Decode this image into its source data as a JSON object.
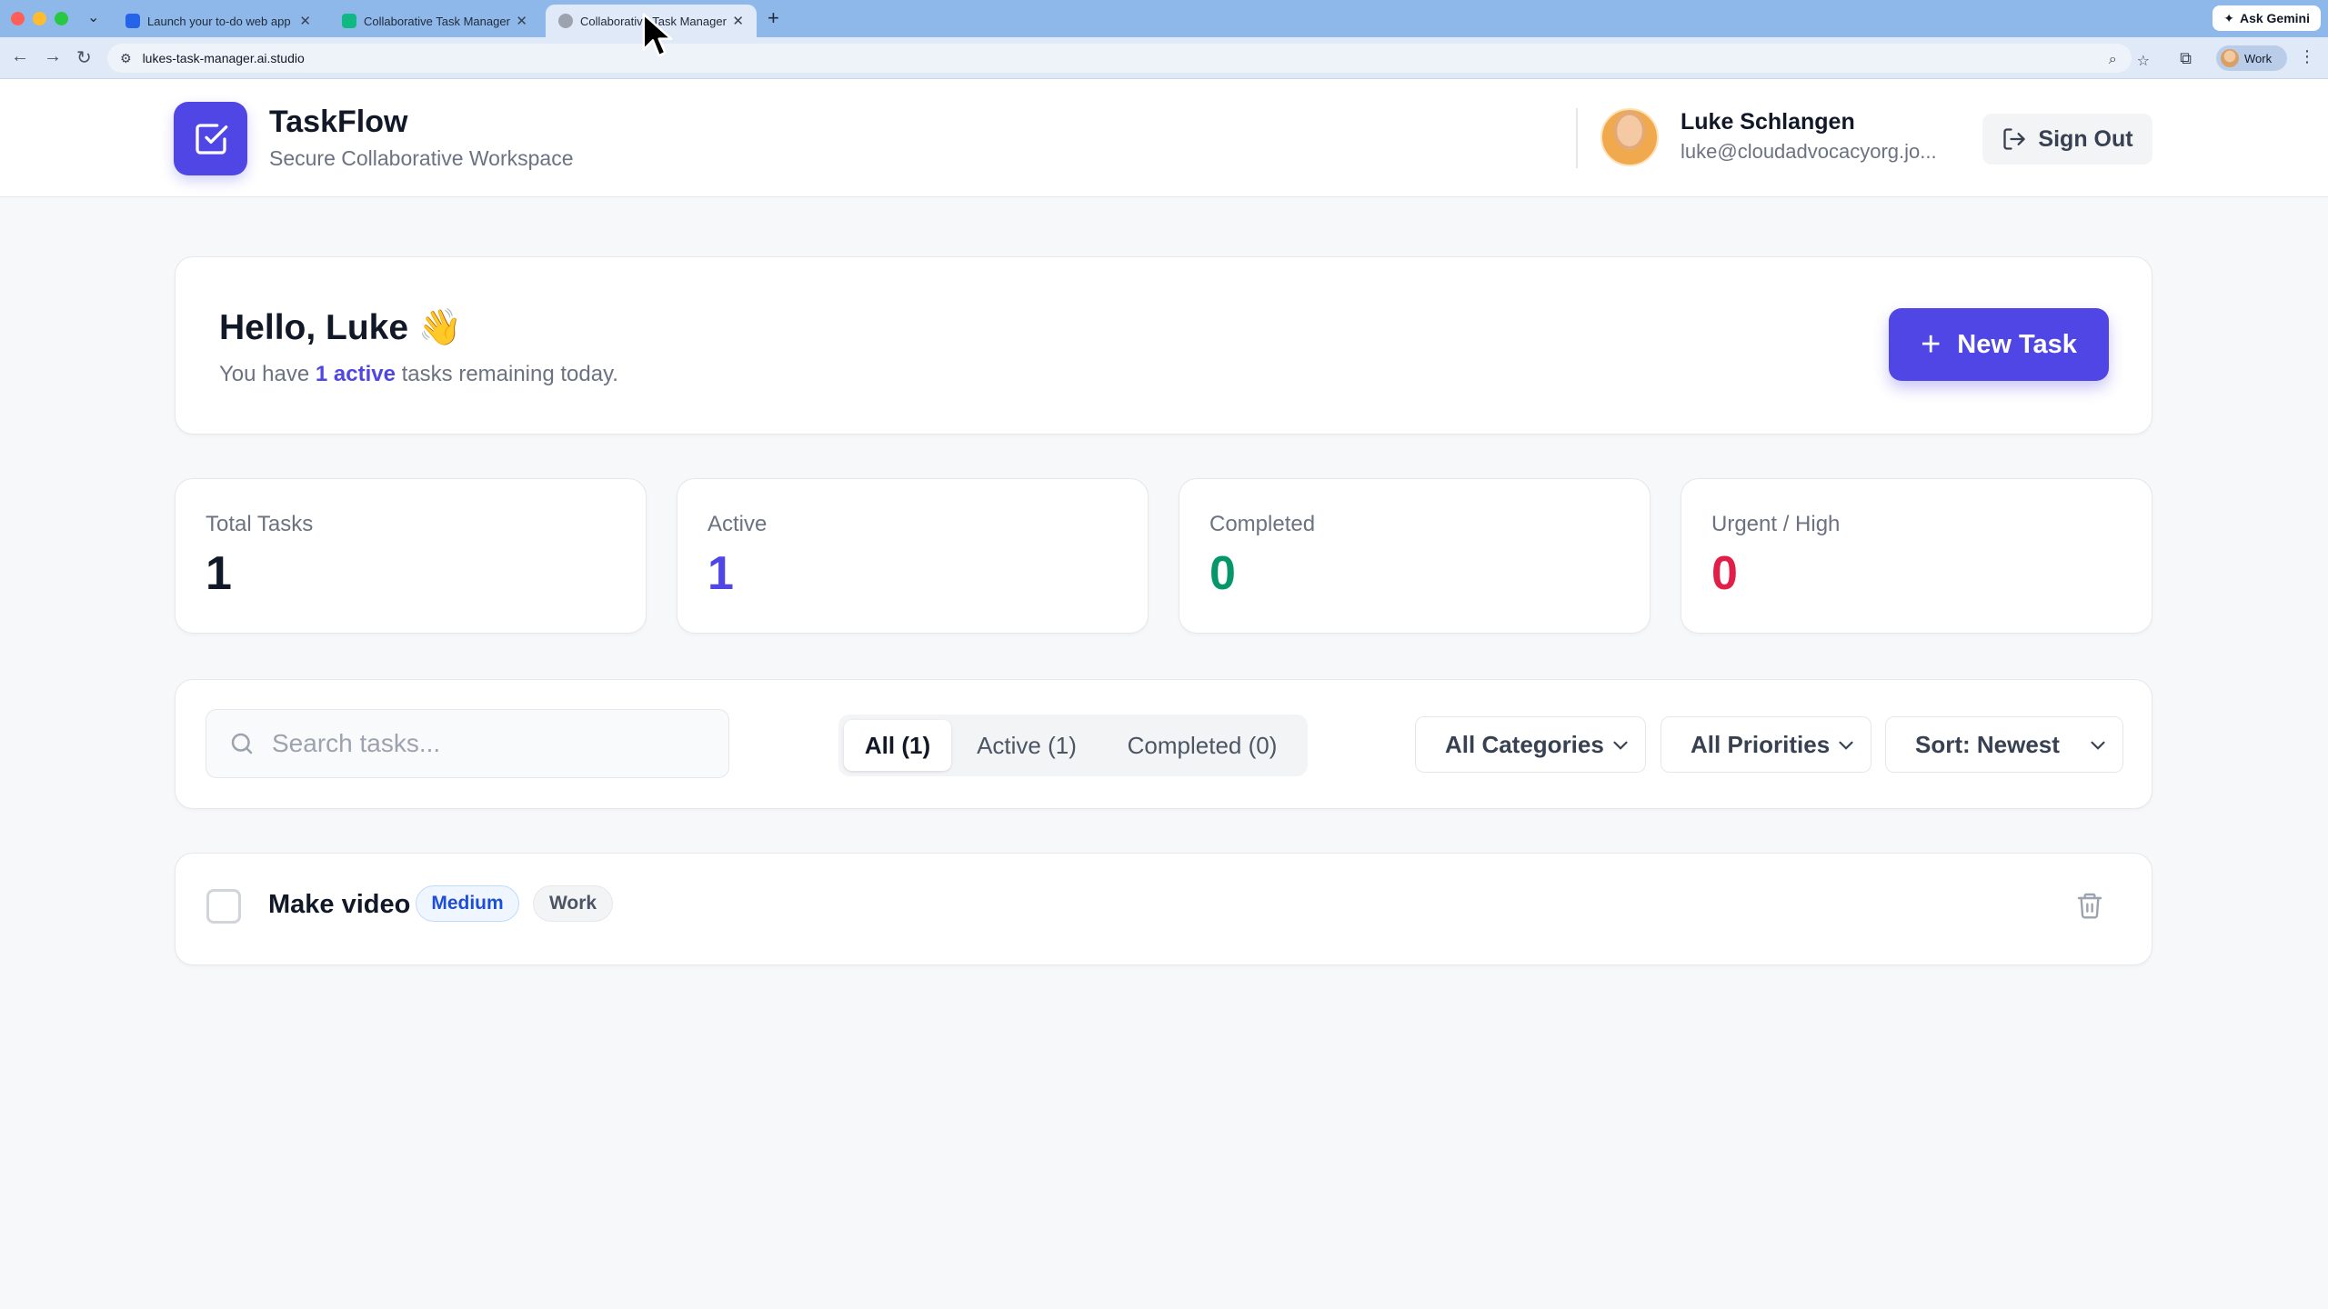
{
  "browser": {
    "tabs": [
      {
        "title": "Launch your to-do web app a",
        "favicon_color": "#2563eb",
        "active": false
      },
      {
        "title": "Collaborative Task Manager |",
        "favicon_color": "#10b981",
        "active": false
      },
      {
        "title": "Collaborative Task Manager",
        "favicon_color": "#9ca3af",
        "active": true
      }
    ],
    "ask_gemini": "Ask Gemini",
    "url": "lukes-task-manager.ai.studio",
    "profile_label": "Work"
  },
  "app": {
    "brand": "TaskFlow",
    "tagline": "Secure Collaborative Workspace",
    "user": {
      "name": "Luke Schlangen",
      "email": "luke@cloudadvocacyorg.jo..."
    },
    "sign_out": "Sign Out"
  },
  "greeting": {
    "title": "Hello, Luke 👋",
    "sub_prefix": "You have ",
    "sub_accent": "1 active",
    "sub_suffix": " tasks remaining today.",
    "new_task": "New Task"
  },
  "stats": [
    {
      "label": "Total Tasks",
      "value": "1",
      "color": "#111827"
    },
    {
      "label": "Active",
      "value": "1",
      "color": "#4f46e5"
    },
    {
      "label": "Completed",
      "value": "0",
      "color": "#059669"
    },
    {
      "label": "Urgent / High",
      "value": "0",
      "color": "#e11d48"
    }
  ],
  "filters": {
    "search_placeholder": "Search tasks...",
    "tabs": [
      {
        "label": "All (1)",
        "active": true
      },
      {
        "label": "Active (1)",
        "active": false
      },
      {
        "label": "Completed (0)",
        "active": false
      }
    ],
    "category": "All Categories",
    "priority": "All Priorities",
    "sort": "Sort: Newest"
  },
  "tasks": [
    {
      "title": "Make video",
      "priority": "Medium",
      "category": "Work",
      "completed": false
    }
  ]
}
